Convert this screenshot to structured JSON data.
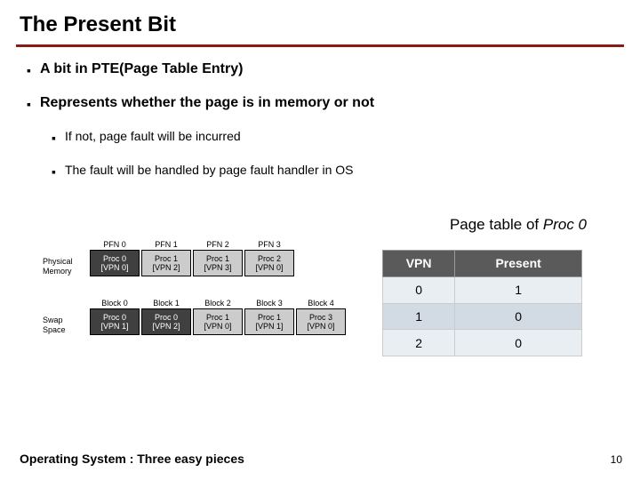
{
  "title": "The Present Bit",
  "bullets": {
    "b1": "A bit in PTE(Page Table Entry)",
    "b2": "Represents whether the page is in memory or not",
    "b2a": "If not, page fault will be incurred",
    "b2b": "The fault will be handled by page fault handler in OS"
  },
  "caption": {
    "prefix": "Page table of ",
    "proc": "Proc 0"
  },
  "labels": {
    "physmem1": "Physical",
    "physmem2": "Memory",
    "swap1": "Swap",
    "swap2": "Space"
  },
  "phys": {
    "heads": [
      "PFN 0",
      "PFN 1",
      "PFN 2",
      "PFN 3"
    ],
    "cells": [
      {
        "l1": "Proc 0",
        "l2": "[VPN 0]",
        "dark": true
      },
      {
        "l1": "Proc 1",
        "l2": "[VPN 2]",
        "dark": false
      },
      {
        "l1": "Proc 1",
        "l2": "[VPN 3]",
        "dark": false
      },
      {
        "l1": "Proc 2",
        "l2": "[VPN 0]",
        "dark": false
      }
    ]
  },
  "swap": {
    "heads": [
      "Block 0",
      "Block 1",
      "Block 2",
      "Block 3",
      "Block 4"
    ],
    "cells": [
      {
        "l1": "Proc 0",
        "l2": "[VPN 1]",
        "dark": true
      },
      {
        "l1": "Proc 0",
        "l2": "[VPN 2]",
        "dark": true
      },
      {
        "l1": "Proc 1",
        "l2": "[VPN 0]",
        "dark": false
      },
      {
        "l1": "Proc 1",
        "l2": "[VPN 1]",
        "dark": false
      },
      {
        "l1": "Proc 3",
        "l2": "[VPN 0]",
        "dark": false
      }
    ]
  },
  "ptable": {
    "headers": {
      "vpn": "VPN",
      "present": "Present"
    },
    "rows": [
      {
        "vpn": "0",
        "present": "1"
      },
      {
        "vpn": "1",
        "present": "0"
      },
      {
        "vpn": "2",
        "present": "0"
      }
    ]
  },
  "footer": "Operating System : Three easy pieces",
  "pagenum": "10",
  "marker": "▪"
}
